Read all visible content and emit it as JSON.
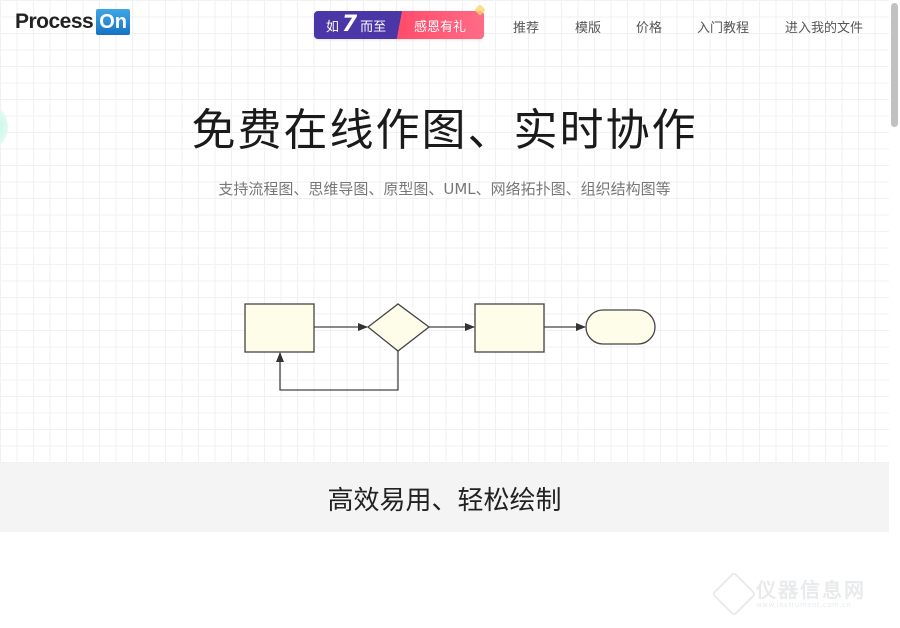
{
  "header": {
    "logo": {
      "text": "Process",
      "badge": "On"
    },
    "promo": {
      "left_prefix": "如",
      "left_number": "7",
      "left_suffix": "而至",
      "right_text": "感恩有礼"
    },
    "nav": [
      {
        "label": "推荐"
      },
      {
        "label": "模版"
      },
      {
        "label": "价格"
      },
      {
        "label": "入门教程"
      },
      {
        "label": "进入我的文件"
      }
    ]
  },
  "hero": {
    "title": "免费在线作图、实时协作",
    "subtitle": "支持流程图、思维导图、原型图、UML、网络拓扑图、组织结构图等"
  },
  "diagram": {
    "shapes": [
      "process",
      "decision",
      "process",
      "terminator"
    ],
    "colors": {
      "fill": "#fdfdea",
      "stroke": "#444444"
    }
  },
  "section": {
    "title": "高效易用、轻松绘制"
  },
  "watermark": {
    "name": "仪器信息网",
    "url": "www.instrument.com.cn"
  },
  "colors": {
    "logo_badge": "#1f86d3",
    "promo_left": "#4a36a7",
    "promo_right": "#ff4b6a",
    "band": "#f4f4f4"
  }
}
